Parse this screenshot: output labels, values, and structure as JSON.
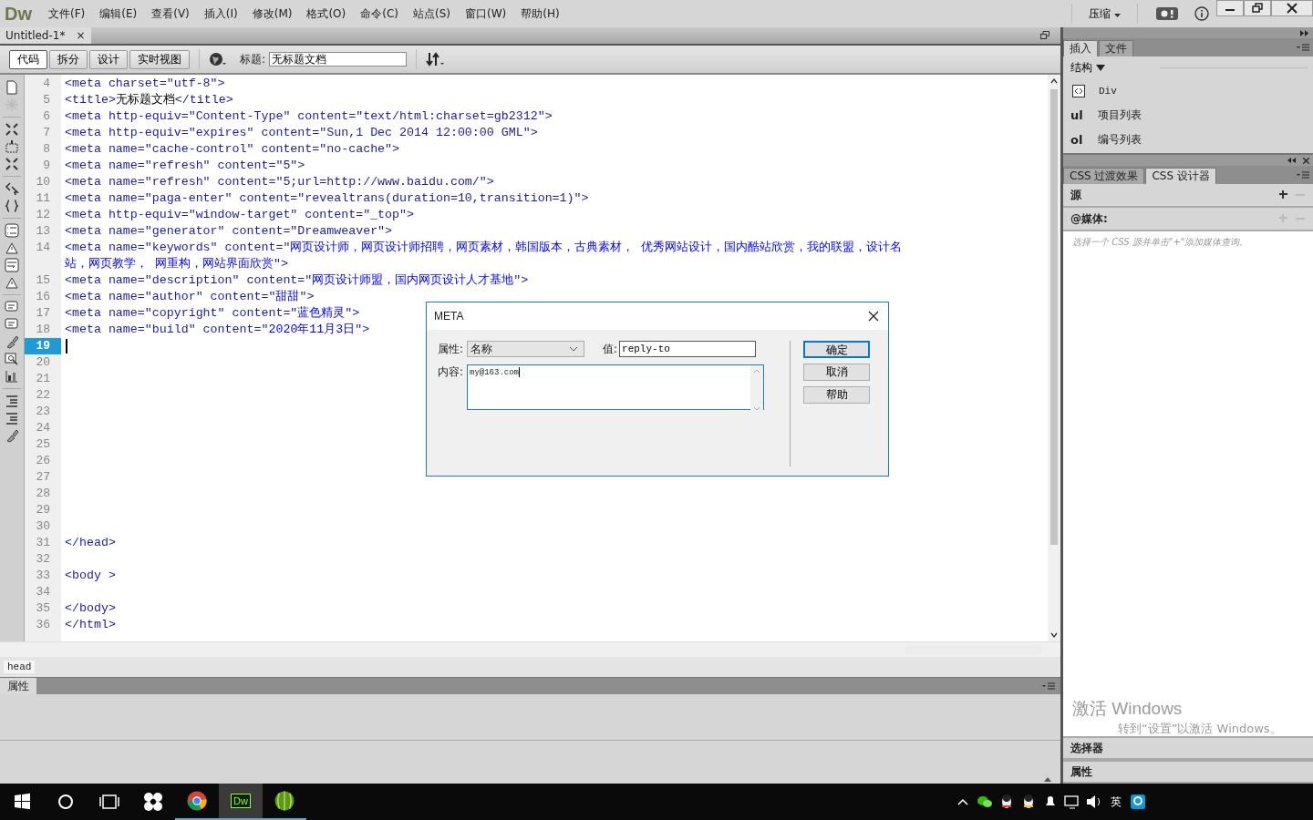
{
  "app": {
    "logo": "Dw",
    "menus": [
      "文件(F)",
      "编辑(E)",
      "查看(V)",
      "插入(I)",
      "修改(M)",
      "格式(O)",
      "命令(C)",
      "站点(S)",
      "窗口(W)",
      "帮助(H)"
    ],
    "workspace": "压缩"
  },
  "document_tab": {
    "title": "Untitled-1*",
    "close": "×"
  },
  "toolbar": {
    "views": [
      {
        "label": "代码",
        "selected": true
      },
      {
        "label": "拆分",
        "selected": false
      },
      {
        "label": "设计",
        "selected": false
      },
      {
        "label": "实时视图",
        "selected": false
      }
    ],
    "title_label": "标题:",
    "title_value": "无标题文档"
  },
  "code_lines": [
    {
      "num": "4",
      "segments": [
        {
          "kind": "markup",
          "t": "<meta charset=\"utf-8\">"
        }
      ]
    },
    {
      "num": "5",
      "segments": [
        {
          "kind": "markup",
          "t": "<title>"
        },
        {
          "kind": "text",
          "t": "无标题文档"
        },
        {
          "kind": "markup",
          "t": "</title>"
        }
      ]
    },
    {
      "num": "6",
      "segments": [
        {
          "kind": "markup",
          "t": "<meta http-equiv=\"Content-Type\" content=\"text/html:charset=gb2312\">"
        }
      ]
    },
    {
      "num": "7",
      "segments": [
        {
          "kind": "markup",
          "t": "<meta http-equiv=\"expires\" content=\"Sun,1 Dec 2014 12:00:00 GML\">"
        }
      ]
    },
    {
      "num": "8",
      "segments": [
        {
          "kind": "markup",
          "t": "<meta name=\"cache-control\" content=\"no-cache\">"
        }
      ]
    },
    {
      "num": "9",
      "segments": [
        {
          "kind": "markup",
          "t": "<meta name=\"refresh\" content=\"5\">"
        }
      ]
    },
    {
      "num": "10",
      "segments": [
        {
          "kind": "markup",
          "t": "<meta name=\"refresh\" content=\"5;url=http://www.baidu.com/\">"
        }
      ]
    },
    {
      "num": "11",
      "segments": [
        {
          "kind": "markup",
          "t": "<meta name=\"paga-enter\" content=\"revealtrans(duration=10,transition=1)\">"
        }
      ]
    },
    {
      "num": "12",
      "segments": [
        {
          "kind": "markup",
          "t": "<meta http-equiv=\"window-target\" content=\"_top\">"
        }
      ]
    },
    {
      "num": "13",
      "segments": [
        {
          "kind": "markup",
          "t": "<meta name=\"generator\" content=\"Dreamweaver\">"
        }
      ]
    },
    {
      "num": "14",
      "segments": [
        {
          "kind": "markup",
          "t": "<meta name=\"keywords\" content=\""
        },
        {
          "kind": "content",
          "t": "网页设计师，网页设计师招聘，网页素材，韩国版本，古典素材， 优秀网站设计，国内酷站欣赏，我的联盟，设计名"
        }
      ],
      "continuation": [
        {
          "kind": "content",
          "t": "站，网页教学， 网重构，网站界面欣赏"
        },
        {
          "kind": "markup",
          "t": "\">"
        }
      ]
    },
    {
      "num": "15",
      "segments": [
        {
          "kind": "markup",
          "t": "<meta name=\"description\" content=\""
        },
        {
          "kind": "content",
          "t": "网页设计师盟，国内网页设计人才基地"
        },
        {
          "kind": "markup",
          "t": "\">"
        }
      ]
    },
    {
      "num": "16",
      "segments": [
        {
          "kind": "markup",
          "t": "<meta name=\"author\" content=\""
        },
        {
          "kind": "content",
          "t": "甜甜"
        },
        {
          "kind": "markup",
          "t": "\">"
        }
      ]
    },
    {
      "num": "17",
      "segments": [
        {
          "kind": "markup",
          "t": "<meta name=\"copyright\" content=\""
        },
        {
          "kind": "content",
          "t": "蓝色精灵"
        },
        {
          "kind": "markup",
          "t": "\">"
        }
      ]
    },
    {
      "num": "18",
      "segments": [
        {
          "kind": "markup",
          "t": "<meta name=\"build\" content=\""
        },
        {
          "kind": "content",
          "t": "2020年11月3日"
        },
        {
          "kind": "markup",
          "t": "\">"
        }
      ]
    },
    {
      "num": "19",
      "current": true
    },
    {
      "num": "20"
    },
    {
      "num": "21"
    },
    {
      "num": "22"
    },
    {
      "num": "23"
    },
    {
      "num": "24"
    },
    {
      "num": "25"
    },
    {
      "num": "26"
    },
    {
      "num": "27"
    },
    {
      "num": "28"
    },
    {
      "num": "29"
    },
    {
      "num": "30"
    },
    {
      "num": "31",
      "segments": [
        {
          "kind": "markup",
          "t": "</head>"
        }
      ]
    },
    {
      "num": "32"
    },
    {
      "num": "33",
      "segments": [
        {
          "kind": "markup",
          "t": "<body >"
        }
      ]
    },
    {
      "num": "34"
    },
    {
      "num": "35",
      "segments": [
        {
          "kind": "markup",
          "t": "</body>"
        }
      ]
    },
    {
      "num": "36",
      "segments": [
        {
          "kind": "markup",
          "t": "</html>"
        }
      ]
    }
  ],
  "tag_selector": "head",
  "properties_panel": {
    "title": "属性"
  },
  "insert_panel": {
    "tabs": [
      {
        "label": "插入",
        "selected": true
      },
      {
        "label": "文件",
        "selected": false
      }
    ],
    "category": "结构",
    "items": [
      {
        "marker": "",
        "label": "Div",
        "kind": "icon"
      },
      {
        "marker": "ul",
        "label": "项目列表",
        "kind": "text"
      },
      {
        "marker": "ol",
        "label": "编号列表",
        "kind": "text"
      }
    ]
  },
  "css_panel": {
    "tabs": [
      {
        "label": "CSS 过渡效果",
        "selected": false
      },
      {
        "label": "CSS 设计器",
        "selected": true
      }
    ],
    "sources": "源",
    "media": "@媒体:",
    "hint": "选择一个 CSS 源并单击\"+\"添加媒体查询。",
    "selectors": "选择器",
    "properties": "属性"
  },
  "activation_notice": {
    "title": "激活 Windows",
    "text": "转到“设置”以激活 Windows。"
  },
  "dialog": {
    "title": "META",
    "attribute_label": "属性:",
    "attribute_value": "名称",
    "value_label": "值:",
    "value": "reply-to",
    "content_label": "内容:",
    "content": "my@163.com",
    "buttons": [
      {
        "label": "确定",
        "default": true
      },
      {
        "label": "取消",
        "default": false
      },
      {
        "label": "帮助",
        "default": false
      }
    ]
  },
  "taskbar": {
    "dw_label": "Dw",
    "ime": "英"
  }
}
